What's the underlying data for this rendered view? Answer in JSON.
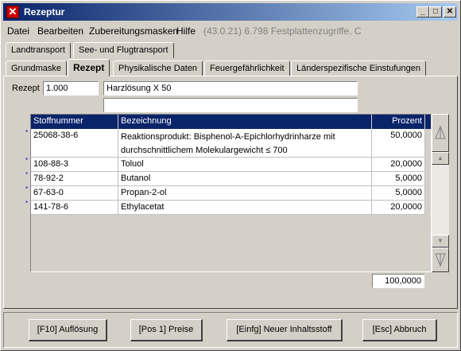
{
  "window": {
    "title": "Rezeptur"
  },
  "menubar": {
    "items": [
      "Datei",
      "Bearbeiten",
      "Zubereitungsmasken",
      "Hilfe"
    ],
    "info": "(43.0.21) 6.798 Festplattenzugriffe, C"
  },
  "outer_tabs": [
    "Landtransport",
    "See- und Flugtransport"
  ],
  "inner_tabs": [
    "Grundmaske",
    "Rezept",
    "Physikalische Daten",
    "Feuergefährlichkeit",
    "Länderspezifische Einstufungen"
  ],
  "active_inner_tab": "Rezept",
  "recipe": {
    "label": "Rezept",
    "number": "1.000",
    "name": "Harzlösung X 50",
    "name2": ""
  },
  "table": {
    "columns": [
      "Stoffnummer",
      "Bezeichnung",
      "Prozent"
    ],
    "rows": [
      {
        "marker": "*",
        "nummer": "25068-38-6",
        "bez1": "Reaktionsprodukt: Bisphenol-A-Epichlorhydrinharze mit",
        "bez2": "durchschnittlichem Molekulargewicht ≤ 700",
        "prozent": "50,0000"
      },
      {
        "marker": "*",
        "nummer": "108-88-3",
        "bez1": "Toluol",
        "prozent": "20,0000"
      },
      {
        "marker": "*",
        "nummer": "78-92-2",
        "bez1": "Butanol",
        "prozent": "5,0000"
      },
      {
        "marker": "*",
        "nummer": "67-63-0",
        "bez1": "Propan-2-ol",
        "prozent": "5,0000"
      },
      {
        "marker": "*",
        "nummer": "141-78-6",
        "bez1": "Ethylacetat",
        "prozent": "20,0000"
      }
    ],
    "total": "100,0000"
  },
  "buttons": {
    "aufloesung": "[F10] Auflösung",
    "preise": "[Pos 1] Preise",
    "neuer": "[Einfg] Neuer Inhaltsstoff",
    "abbruch": "[Esc] Abbruch"
  }
}
